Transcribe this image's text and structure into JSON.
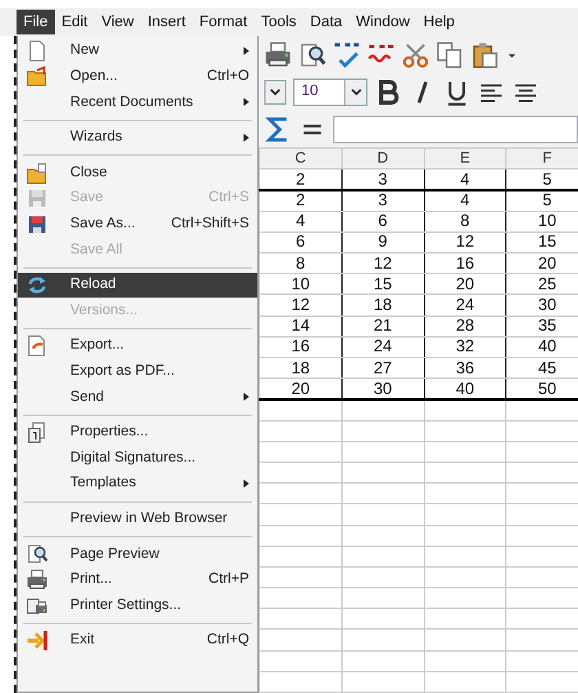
{
  "menubar": [
    {
      "label": "File",
      "selected": true
    },
    {
      "label": "Edit",
      "selected": false
    },
    {
      "label": "View",
      "selected": false
    },
    {
      "label": "Insert",
      "selected": false
    },
    {
      "label": "Format",
      "selected": false
    },
    {
      "label": "Tools",
      "selected": false
    },
    {
      "label": "Data",
      "selected": false
    },
    {
      "label": "Window",
      "selected": false
    },
    {
      "label": "Help",
      "selected": false
    }
  ],
  "file_menu": [
    {
      "kind": "item",
      "label": "New",
      "submenu": true,
      "disabled": false,
      "selected": false
    },
    {
      "kind": "item",
      "label": "Open...",
      "shortcut": "Ctrl+O",
      "submenu": false,
      "disabled": false,
      "selected": false
    },
    {
      "kind": "item",
      "label": "Recent Documents",
      "submenu": true,
      "disabled": false,
      "selected": false
    },
    {
      "kind": "separator"
    },
    {
      "kind": "item",
      "label": "Wizards",
      "submenu": true,
      "disabled": false,
      "selected": false
    },
    {
      "kind": "separator"
    },
    {
      "kind": "item",
      "label": "Close",
      "submenu": false,
      "disabled": false,
      "selected": false
    },
    {
      "kind": "item",
      "label": "Save",
      "shortcut": "Ctrl+S",
      "submenu": false,
      "disabled": true,
      "selected": false
    },
    {
      "kind": "item",
      "label": "Save As...",
      "shortcut": "Ctrl+Shift+S",
      "submenu": false,
      "disabled": false,
      "selected": false
    },
    {
      "kind": "item",
      "label": "Save All",
      "submenu": false,
      "disabled": true,
      "selected": false
    },
    {
      "kind": "separator"
    },
    {
      "kind": "item",
      "label": "Reload",
      "submenu": false,
      "disabled": false,
      "selected": true
    },
    {
      "kind": "item",
      "label": "Versions...",
      "submenu": false,
      "disabled": true,
      "selected": false
    },
    {
      "kind": "separator"
    },
    {
      "kind": "item",
      "label": "Export...",
      "submenu": false,
      "disabled": false,
      "selected": false
    },
    {
      "kind": "item",
      "label": "Export as PDF...",
      "submenu": false,
      "disabled": false,
      "selected": false
    },
    {
      "kind": "item",
      "label": "Send",
      "submenu": true,
      "disabled": false,
      "selected": false
    },
    {
      "kind": "separator"
    },
    {
      "kind": "item",
      "label": "Properties...",
      "submenu": false,
      "disabled": false,
      "selected": false
    },
    {
      "kind": "item",
      "label": "Digital Signatures...",
      "submenu": false,
      "disabled": false,
      "selected": false
    },
    {
      "kind": "item",
      "label": "Templates",
      "submenu": true,
      "disabled": false,
      "selected": false
    },
    {
      "kind": "separator"
    },
    {
      "kind": "item",
      "label": "Preview in Web Browser",
      "submenu": false,
      "disabled": false,
      "selected": false
    },
    {
      "kind": "separator"
    },
    {
      "kind": "item",
      "label": "Page Preview",
      "submenu": false,
      "disabled": false,
      "selected": false
    },
    {
      "kind": "item",
      "label": "Print...",
      "shortcut": "Ctrl+P",
      "submenu": false,
      "disabled": false,
      "selected": false
    },
    {
      "kind": "item",
      "label": "Printer Settings...",
      "submenu": false,
      "disabled": false,
      "selected": false
    },
    {
      "kind": "separator"
    },
    {
      "kind": "item",
      "label": "Exit",
      "shortcut": "Ctrl+Q",
      "submenu": false,
      "disabled": false,
      "selected": false
    }
  ],
  "toolbar": {
    "font_size": "10"
  },
  "sheet": {
    "columns": [
      "C",
      "D",
      "E",
      "F"
    ],
    "rows": [
      [
        "2",
        "3",
        "4",
        "5"
      ],
      [
        "2",
        "3",
        "4",
        "5"
      ],
      [
        "4",
        "6",
        "8",
        "10"
      ],
      [
        "6",
        "9",
        "12",
        "15"
      ],
      [
        "8",
        "12",
        "16",
        "20"
      ],
      [
        "10",
        "15",
        "20",
        "25"
      ],
      [
        "12",
        "18",
        "24",
        "30"
      ],
      [
        "14",
        "21",
        "28",
        "35"
      ],
      [
        "16",
        "24",
        "32",
        "40"
      ],
      [
        "18",
        "27",
        "36",
        "45"
      ],
      [
        "20",
        "30",
        "40",
        "50"
      ]
    ]
  }
}
